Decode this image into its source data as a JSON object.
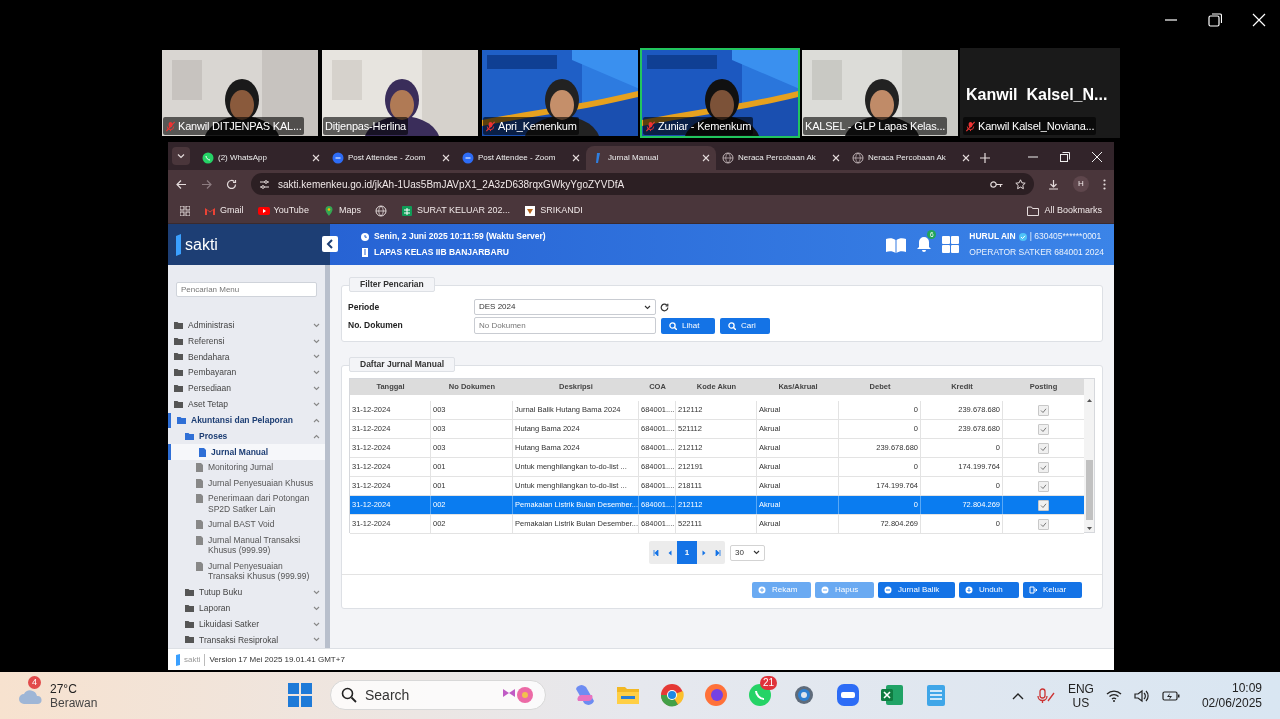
{
  "participants": [
    {
      "kind": "video",
      "name": "Kanwil DITJENPAS KAL...",
      "muted": true,
      "speaking": false
    },
    {
      "kind": "video",
      "name": "Ditjenpas-Herlina",
      "muted": false,
      "speaking": false
    },
    {
      "kind": "video",
      "name": "Apri_Kemenkum",
      "muted": true,
      "speaking": false
    },
    {
      "kind": "video",
      "name": "Zuniar - Kemenkum",
      "muted": true,
      "speaking": true
    },
    {
      "kind": "video",
      "name": "KALSEL - GLP Lapas Kelas...",
      "muted": false,
      "speaking": false
    },
    {
      "kind": "name_card",
      "display_text": "Kanwil  Kalsel_N...",
      "name": "Kanwil Kalsel_Noviana...",
      "muted": true,
      "speaking": false
    }
  ],
  "browser": {
    "tabs": [
      {
        "label": "(2) WhatsApp",
        "selected": false
      },
      {
        "label": "Post Attendee - Zoom",
        "selected": false
      },
      {
        "label": "Post Attendee - Zoom",
        "selected": false
      },
      {
        "label": "Jurnal Manual",
        "selected": true
      },
      {
        "label": "Neraca Percobaan Ak",
        "selected": false
      },
      {
        "label": "Neraca Percobaan Ak",
        "selected": false
      }
    ],
    "url": "sakti.kemenkeu.go.id/jkAh-1Uas5BmJAVpX1_2A3zD638rqxGWkyYgoZYVDfA",
    "profile": "H",
    "bookmarks": [
      {
        "kind": "gmail",
        "label": "Gmail"
      },
      {
        "kind": "youtube",
        "label": "YouTube"
      },
      {
        "kind": "maps",
        "label": "Maps"
      },
      {
        "kind": "globe"
      },
      {
        "kind": "sheet",
        "label": "SURAT KELUAR 202..."
      },
      {
        "kind": "emblem",
        "label": "SRIKANDI"
      }
    ],
    "all_bookmarks": "All Bookmarks"
  },
  "app": {
    "logo": "sakti",
    "header": {
      "datetime": "Senin, 2 Juni 2025 10:11:59 (Waktu Server)",
      "office": "LAPAS KELAS IIB BANJARBARU",
      "notification_count": "6",
      "user_name": "HURUL AIN",
      "user_id": "| 630405******0001",
      "role": "OPERATOR SATKER 684001 2024"
    },
    "sidebar": {
      "search_placeholder": "Pencarian Menu",
      "items": [
        {
          "label": "Administrasi",
          "expanded": false,
          "selected": false
        },
        {
          "label": "Referensi",
          "expanded": false,
          "selected": false
        },
        {
          "label": "Bendahara",
          "expanded": false,
          "selected": false
        },
        {
          "label": "Pembayaran",
          "expanded": false,
          "selected": false
        },
        {
          "label": "Persediaan",
          "expanded": false,
          "selected": false
        },
        {
          "label": "Aset Tetap",
          "expanded": false,
          "selected": false
        },
        {
          "label": "Akuntansi dan Pelaporan",
          "expanded": true,
          "selected": false,
          "children": [
            {
              "label": "Proses",
              "expanded": true,
              "selected": false,
              "children": [
                {
                  "label": "Jurnal Manual",
                  "selected": true
                },
                {
                  "label": "Monitoring Jurnal",
                  "selected": false
                },
                {
                  "label": "Jurnal Penyesuaian Khusus",
                  "selected": false
                },
                {
                  "label": "Penerimaan dari Potongan SP2D Satker Lain",
                  "selected": false
                },
                {
                  "label": "Jurnal BAST Void",
                  "selected": false
                },
                {
                  "label": "Jurnal Manual Transaksi Khusus (999.99)",
                  "selected": false
                },
                {
                  "label": "Jurnal Penyesuaian Transaksi Khusus (999.99)",
                  "selected": false
                }
              ]
            },
            {
              "label": "Tutup Buku",
              "expanded": false,
              "selected": false
            },
            {
              "label": "Laporan",
              "expanded": false,
              "selected": false
            },
            {
              "label": "Likuidasi Satker",
              "expanded": false,
              "selected": false
            },
            {
              "label": "Transaksi Resiprokal",
              "expanded": false,
              "selected": false
            }
          ]
        }
      ]
    },
    "filter": {
      "legend": "Filter Pencarian",
      "periode_label": "Periode",
      "periode_value": "DES 2024",
      "dokumen_label": "No. Dokumen",
      "dokumen_placeholder": "No Dokumen",
      "buttons": [
        "Lihat",
        "Cari"
      ]
    },
    "table": {
      "legend": "Daftar Jurnal Manual",
      "columns": [
        "Tanggal",
        "No Dokumen",
        "Deskripsi",
        "COA",
        "Kode Akun",
        "Kas/Akrual",
        "Debet",
        "Kredit",
        "Posting"
      ],
      "rows": [
        {
          "cells": [
            "31-12-2024",
            "003",
            "Jurnal Balik Hutang Bama 2024",
            "684001....",
            "212112",
            "Akrual",
            "0",
            "239.678.680"
          ],
          "posted": true,
          "selected": false
        },
        {
          "cells": [
            "31-12-2024",
            "003",
            "Hutang Bama 2024",
            "684001....",
            "521112",
            "Akrual",
            "0",
            "239.678.680"
          ],
          "posted": true,
          "selected": false
        },
        {
          "cells": [
            "31-12-2024",
            "003",
            "Hutang Bama 2024",
            "684001....",
            "212112",
            "Akrual",
            "239.678.680",
            "0"
          ],
          "posted": true,
          "selected": false
        },
        {
          "cells": [
            "31-12-2024",
            "001",
            "Untuk menghilangkan to-do-list ...",
            "684001....",
            "212191",
            "Akrual",
            "0",
            "174.199.764"
          ],
          "posted": true,
          "selected": false
        },
        {
          "cells": [
            "31-12-2024",
            "001",
            "Untuk menghilangkan to-do-list ...",
            "684001....",
            "218111",
            "Akrual",
            "174.199.764",
            "0"
          ],
          "posted": true,
          "selected": false
        },
        {
          "cells": [
            "31-12-2024",
            "002",
            "Pemakaian Listrik Bulan Desember...",
            "684001....",
            "212112",
            "Akrual",
            "0",
            "72.804.269"
          ],
          "posted": true,
          "selected": true
        },
        {
          "cells": [
            "31-12-2024",
            "002",
            "Pemakaian Listrik Bulan Desember...",
            "684001....",
            "522111",
            "Akrual",
            "72.804.269",
            "0"
          ],
          "posted": true,
          "selected": false
        }
      ],
      "pages": [
        {
          "label": "1",
          "selected": true
        }
      ],
      "page_size": "30"
    },
    "actions": [
      {
        "label": "Rekam",
        "disabled": true
      },
      {
        "label": "Hapus",
        "disabled": true
      },
      {
        "label": "Jurnal Balik",
        "disabled": false
      },
      {
        "label": "Unduh",
        "disabled": false
      },
      {
        "label": "Keluar",
        "disabled": false
      }
    ],
    "footer": {
      "logo": "sakti",
      "version": "Version 17 Mei 2025 19.01.41 GMT+7"
    }
  },
  "taskbar": {
    "weather_badge": "4",
    "temperature": "27°C",
    "condition": "Berawan",
    "search_placeholder": "Search",
    "whatsapp_badge": "21",
    "language": "ENG",
    "region": "US",
    "time": "10:09",
    "date": "02/06/2025"
  }
}
